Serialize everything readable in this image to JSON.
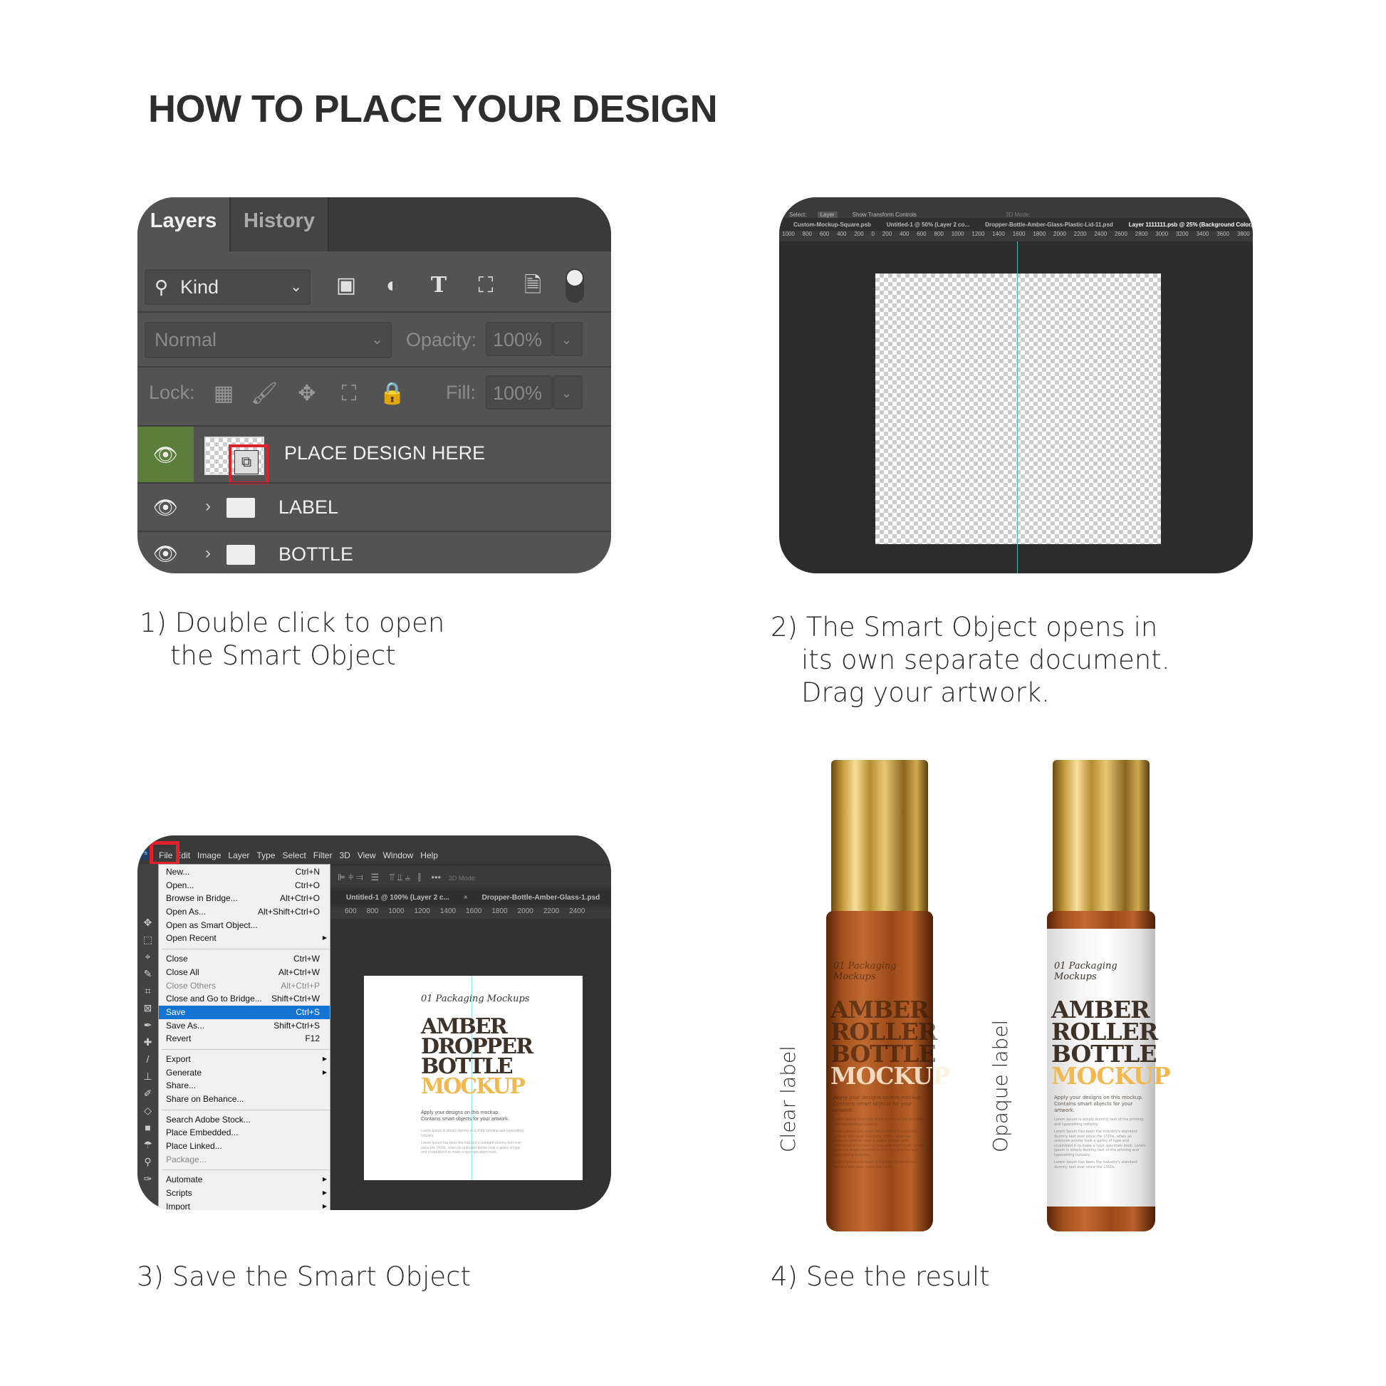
{
  "title": "HOW TO PLACE YOUR DESIGN",
  "steps": {
    "s1": {
      "line1": "1) Double click to open",
      "line2": "the Smart Object"
    },
    "s2": {
      "line1": "2) The Smart Object opens in",
      "line2": "its own separate document.",
      "line3": "Drag your artwork."
    },
    "s3": {
      "line1": "3) Save the Smart Object"
    },
    "s4": {
      "line1": "4) See the result"
    }
  },
  "layers_panel": {
    "tabs": [
      "Layers",
      "History"
    ],
    "filter": "Kind",
    "blend_mode": "Normal",
    "opacity_label": "Opacity:",
    "opacity_value": "100%",
    "lock_label": "Lock:",
    "fill_label": "Fill:",
    "fill_value": "100%",
    "layers": [
      {
        "name": "PLACE DESIGN HERE",
        "type": "smart-object",
        "selected": true
      },
      {
        "name": "LABEL",
        "type": "group"
      },
      {
        "name": "BOTTLE",
        "type": "group"
      }
    ],
    "accent_color": "#5b7f3a",
    "highlight_color": "#e0202a"
  },
  "smart_object_doc": {
    "options": {
      "select": "Select:",
      "layer": "Layer",
      "transform": "Show Transform Controls",
      "mode": "3D Mode:"
    },
    "tabs": [
      "Custom-Mockup-Square.psb",
      "Untitled-1 @ 50% (Layer 2 co...",
      "Dropper-Bottle-Amber-Glass-Plastic-Lid-11.psd",
      "Layer 1111111.psb @ 25% (Background Color, RG"
    ],
    "ruler": [
      "1000",
      "800",
      "600",
      "400",
      "200",
      "0",
      "200",
      "400",
      "600",
      "800",
      "1000",
      "1200",
      "1400",
      "1600",
      "1800",
      "2000",
      "2200",
      "2400",
      "2600",
      "2800",
      "3000",
      "3200",
      "3400",
      "3600",
      "3800"
    ]
  },
  "save_screen": {
    "menubar": [
      "File",
      "Edit",
      "Image",
      "Layer",
      "Type",
      "Select",
      "Filter",
      "3D",
      "View",
      "Window",
      "Help"
    ],
    "tabs": [
      "Untitled-1 @ 100% (Layer 2 c...",
      "Dropper-Bottle-Amber-Glass-1.psd"
    ],
    "ruler": [
      "600",
      "800",
      "1000",
      "1200",
      "1400",
      "1600",
      "1800",
      "2000",
      "2200",
      "2400"
    ],
    "mode": "3D Mode:",
    "menu": [
      [
        {
          "label": "New...",
          "shortcut": "Ctrl+N"
        },
        {
          "label": "Open...",
          "shortcut": "Ctrl+O"
        },
        {
          "label": "Browse in Bridge...",
          "shortcut": "Alt+Ctrl+O"
        },
        {
          "label": "Open As...",
          "shortcut": "Alt+Shift+Ctrl+O"
        },
        {
          "label": "Open as Smart Object...",
          "shortcut": ""
        },
        {
          "label": "Open Recent",
          "shortcut": "",
          "sub": true
        }
      ],
      [
        {
          "label": "Close",
          "shortcut": "Ctrl+W"
        },
        {
          "label": "Close All",
          "shortcut": "Alt+Ctrl+W"
        },
        {
          "label": "Close Others",
          "shortcut": "Alt+Ctrl+P",
          "disabled": true
        },
        {
          "label": "Close and Go to Bridge...",
          "shortcut": "Shift+Ctrl+W"
        },
        {
          "label": "Save",
          "shortcut": "Ctrl+S",
          "highlighted": true
        },
        {
          "label": "Save As...",
          "shortcut": "Shift+Ctrl+S"
        },
        {
          "label": "Revert",
          "shortcut": "F12"
        }
      ],
      [
        {
          "label": "Export",
          "shortcut": "",
          "sub": true
        },
        {
          "label": "Generate",
          "shortcut": "",
          "sub": true
        },
        {
          "label": "Share...",
          "shortcut": ""
        },
        {
          "label": "Share on Behance...",
          "shortcut": ""
        }
      ],
      [
        {
          "label": "Search Adobe Stock...",
          "shortcut": ""
        },
        {
          "label": "Place Embedded...",
          "shortcut": ""
        },
        {
          "label": "Place Linked...",
          "shortcut": ""
        },
        {
          "label": "Package...",
          "shortcut": "",
          "disabled": true
        }
      ],
      [
        {
          "label": "Automate",
          "shortcut": "",
          "sub": true
        },
        {
          "label": "Scripts",
          "shortcut": "",
          "sub": true
        },
        {
          "label": "Import",
          "shortcut": "",
          "sub": true
        }
      ]
    ],
    "artwork": {
      "script": "01 Packaging Mockups",
      "lines": [
        "AMBER",
        "DROPPER",
        "BOTTLE"
      ],
      "accent_line": "MOCKUP",
      "tagline1": "Apply your designs on this mockup.",
      "tagline2": "Contains smart objects for your artwork.",
      "body1": "Lorem Ipsum is simply dummy text of the printing and typesetting industry.",
      "body2": "Lorem Ipsum has been the industry's standard dummy text ever since the 1500s, when an unknown printer took a galley of type and scrambled it to make a type specimen book."
    }
  },
  "result": {
    "clear_label": "Clear label",
    "opaque_label": "Opaque label",
    "label": {
      "script": "01 Packaging Mockups",
      "lines": [
        "AMBER",
        "ROLLER",
        "BOTTLE"
      ],
      "accent_line": "MOCKUP",
      "tagline1": "Apply your designs on this mockup.",
      "tagline2": "Contains smart objects for your artwork.",
      "body1": "Lorem Ipsum is simply dummy text of the printing and typesetting industry.",
      "body2": "Lorem Ipsum has been the industry's standard dummy text ever since the 1500s, when an unknown printer took a galley of type and scrambled it to make a type specimen book. Lorem Ipsum is simply dummy text of the printing and typesetting industry.",
      "body3": "Lorem Ipsum has been the industry's standard dummy text ever since the 1500s."
    },
    "accent_color": "#f0b84e",
    "dark_text_color": "#3e3228"
  }
}
